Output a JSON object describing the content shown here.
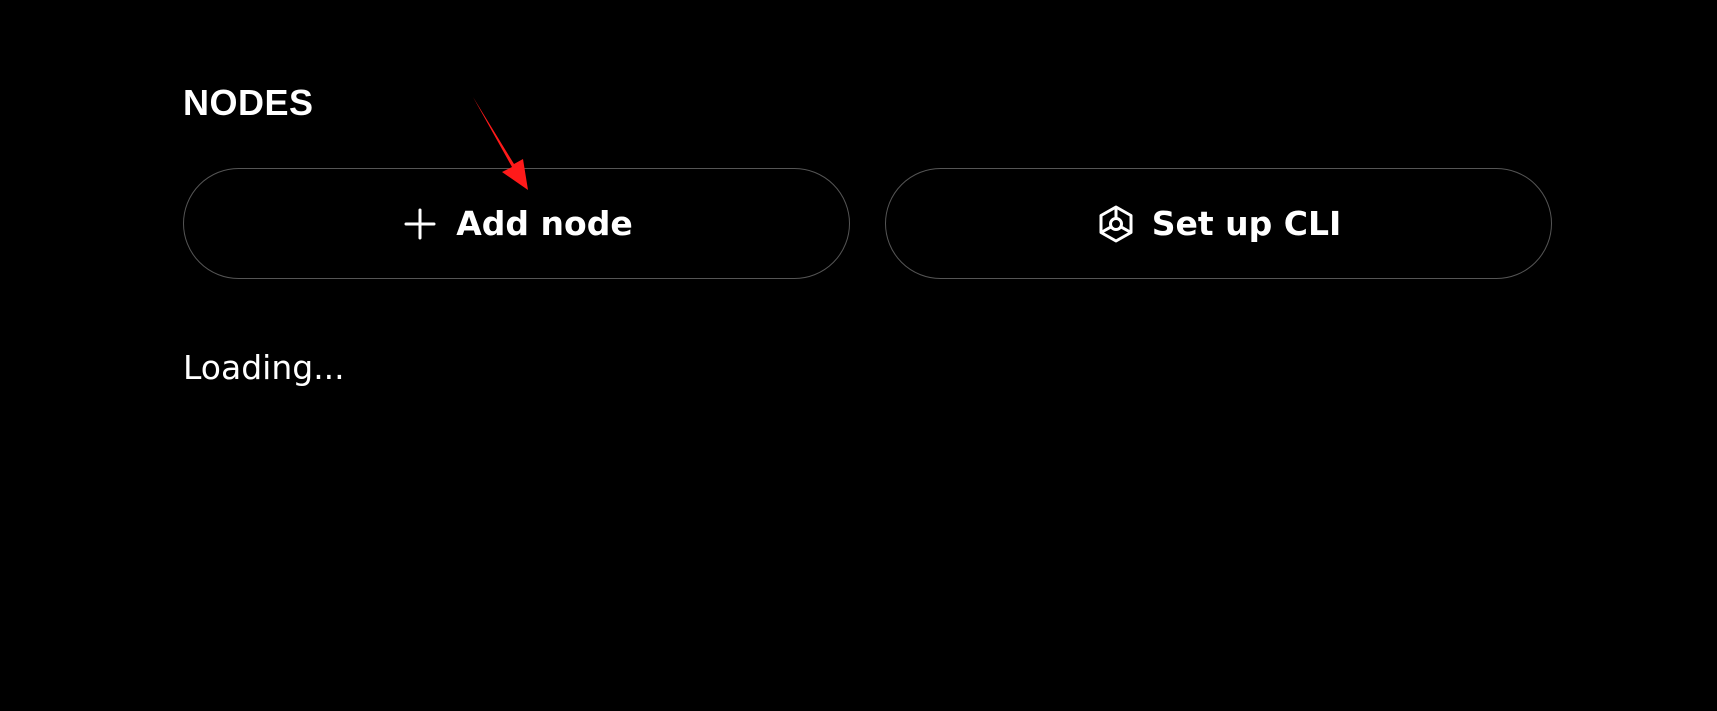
{
  "nodes_section": {
    "title": "NODES",
    "add_node_button": {
      "label": "Add node",
      "icon": "plus-icon"
    },
    "setup_cli_button": {
      "label": "Set up CLI",
      "icon": "cube-icon"
    },
    "loading_text": "Loading..."
  },
  "colors": {
    "background": "#000000",
    "text": "#ffffff",
    "button_border": "#555555",
    "annotation_arrow": "#ff1a1a"
  }
}
